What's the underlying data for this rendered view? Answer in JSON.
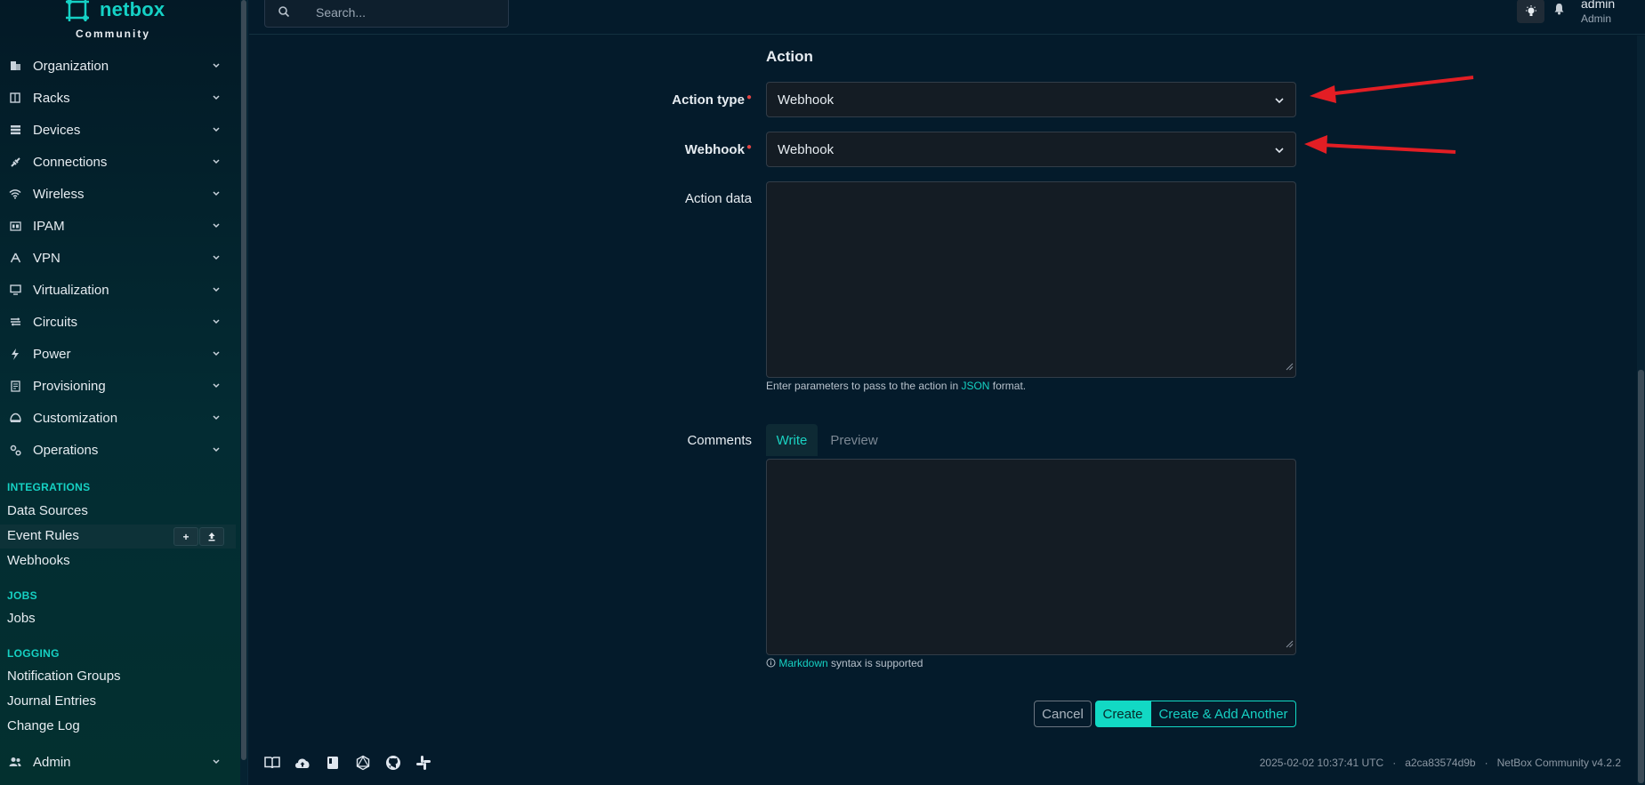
{
  "brand": {
    "name": "netbox",
    "sub": "Community"
  },
  "nav": [
    {
      "label": "Organization",
      "icon": "building-icon"
    },
    {
      "label": "Racks",
      "icon": "rack-icon"
    },
    {
      "label": "Devices",
      "icon": "server-icon"
    },
    {
      "label": "Connections",
      "icon": "plug-icon"
    },
    {
      "label": "Wireless",
      "icon": "wifi-icon"
    },
    {
      "label": "IPAM",
      "icon": "ip-icon"
    },
    {
      "label": "VPN",
      "icon": "vpn-icon"
    },
    {
      "label": "Virtualization",
      "icon": "monitor-icon"
    },
    {
      "label": "Circuits",
      "icon": "circuit-icon"
    },
    {
      "label": "Power",
      "icon": "bolt-icon"
    },
    {
      "label": "Provisioning",
      "icon": "file-icon"
    },
    {
      "label": "Customization",
      "icon": "palette-icon"
    },
    {
      "label": "Operations",
      "icon": "gears-icon"
    }
  ],
  "integrations": {
    "heading": "INTEGRATIONS",
    "items": [
      "Data Sources",
      "Event Rules",
      "Webhooks"
    ]
  },
  "jobs": {
    "heading": "JOBS",
    "items": [
      "Jobs"
    ]
  },
  "logging": {
    "heading": "LOGGING",
    "items": [
      "Notification Groups",
      "Journal Entries",
      "Change Log"
    ]
  },
  "admin": {
    "label": "Admin"
  },
  "search": {
    "placeholder": "Search..."
  },
  "user": {
    "name": "admin",
    "role": "Admin"
  },
  "form": {
    "section_title": "Action",
    "action_type": {
      "label": "Action type",
      "value": "Webhook"
    },
    "webhook": {
      "label": "Webhook",
      "value": "Webhook"
    },
    "action_data": {
      "label": "Action data",
      "value": "",
      "help_prefix": "Enter parameters to pass to the action in ",
      "help_link": "JSON",
      "help_suffix": " format."
    },
    "comments": {
      "label": "Comments",
      "tab_write": "Write",
      "tab_preview": "Preview",
      "value": "",
      "help_link": "Markdown",
      "help_suffix": " syntax is supported"
    },
    "buttons": {
      "cancel": "Cancel",
      "create": "Create",
      "create_another": "Create & Add Another"
    }
  },
  "footer": {
    "timestamp": "2025-02-02 10:37:41 UTC",
    "commit": "a2ca83574d9b",
    "version": "NetBox Community v4.2.2"
  },
  "colors": {
    "accent": "#16d1c3",
    "required": "#e04545",
    "arrow": "#e31e24"
  }
}
